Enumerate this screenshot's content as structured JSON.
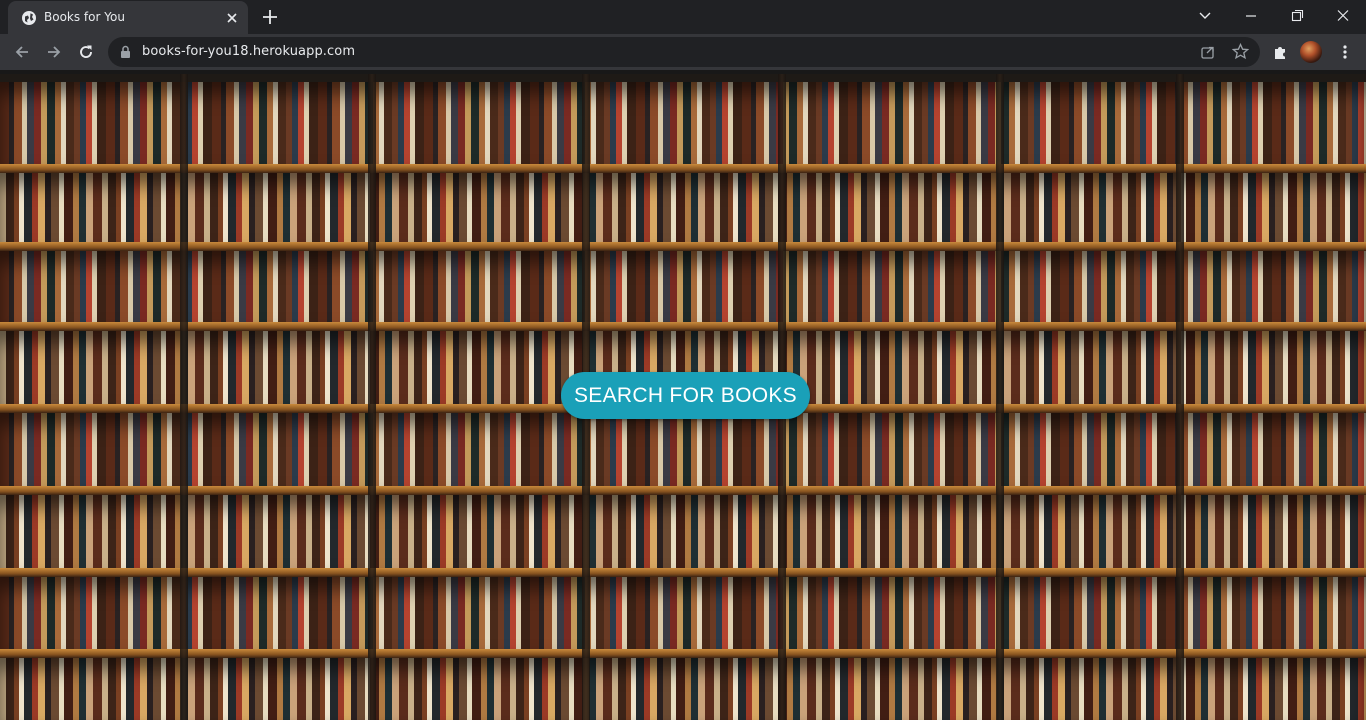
{
  "browser": {
    "tab": {
      "title": "Books for You",
      "favicon": "globe-icon"
    },
    "url": "books-for-you18.herokuapp.com",
    "icons": {
      "back": "arrow-left-icon",
      "forward": "arrow-right-icon",
      "reload": "reload-icon",
      "lock": "lock-icon",
      "share": "share-icon",
      "bookmark": "star-icon",
      "extensions": "puzzle-icon",
      "profile": "avatar",
      "menu": "kebab-menu-icon"
    }
  },
  "page": {
    "background": "bookshelf-photo",
    "search_button_label": "SEARCH FOR BOOKS",
    "accent_color": "#1aa0b8"
  }
}
